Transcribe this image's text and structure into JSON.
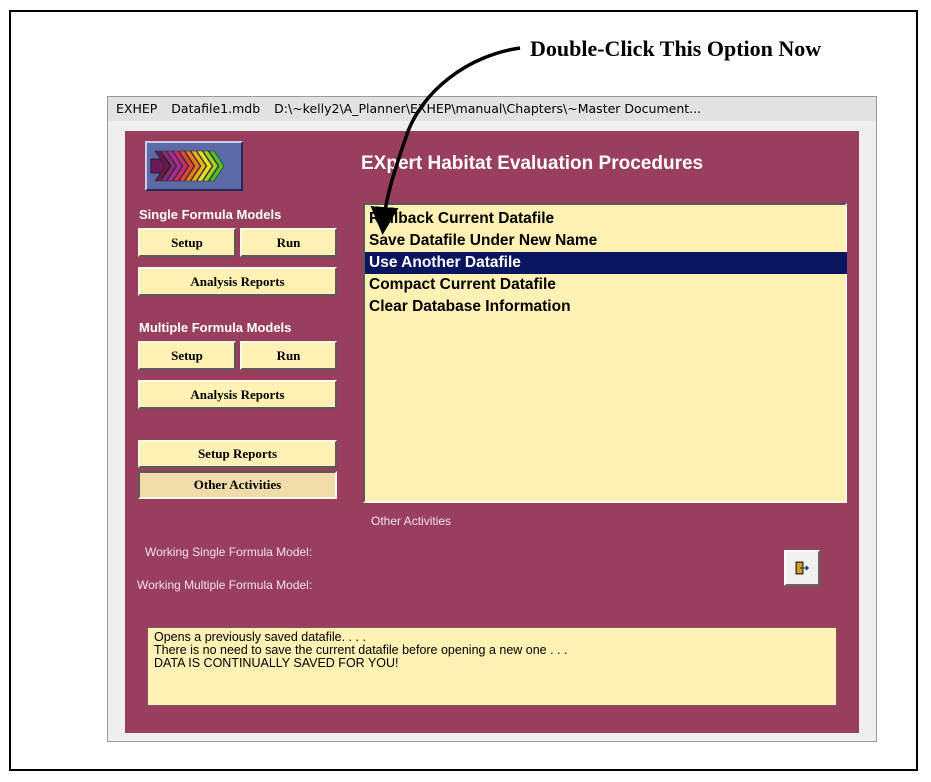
{
  "callout": {
    "text": "Double-Click This Option Now"
  },
  "titlebar": {
    "app": "EXHEP",
    "file": "Datafile1.mdb",
    "path": "D:\\~kelly2\\A_Planner\\EXHEP\\manual\\Chapters\\~Master Document..."
  },
  "app_title": "EXpert Habitat Evaluation Procedures",
  "single": {
    "label": "Single Formula Models",
    "setup": "Setup",
    "run": "Run",
    "reports": "Analysis Reports"
  },
  "multiple": {
    "label": "Multiple Formula Models",
    "setup": "Setup",
    "run": "Run",
    "reports": "Analysis Reports"
  },
  "setup_reports": "Setup Reports",
  "other_activities": "Other Activities",
  "list": {
    "items": [
      "Rollback Current Datafile",
      "Save Datafile Under New Name",
      "Use Another Datafile",
      "Compact Current Datafile",
      "Clear Database Information"
    ],
    "selected_index": 2,
    "caption": "Other Activities"
  },
  "working": {
    "single": "Working Single Formula Model:",
    "multiple": "Working Multiple Formula Model:"
  },
  "status": {
    "lines": [
      "Opens a previously saved datafile. . . .",
      "There is no need to save the current datafile before opening a new one . . .",
      "DATA IS CONTINUALLY SAVED FOR YOU!"
    ]
  },
  "icons": {
    "logo": "arrows-logo-icon",
    "exit": "exit-door-icon"
  }
}
